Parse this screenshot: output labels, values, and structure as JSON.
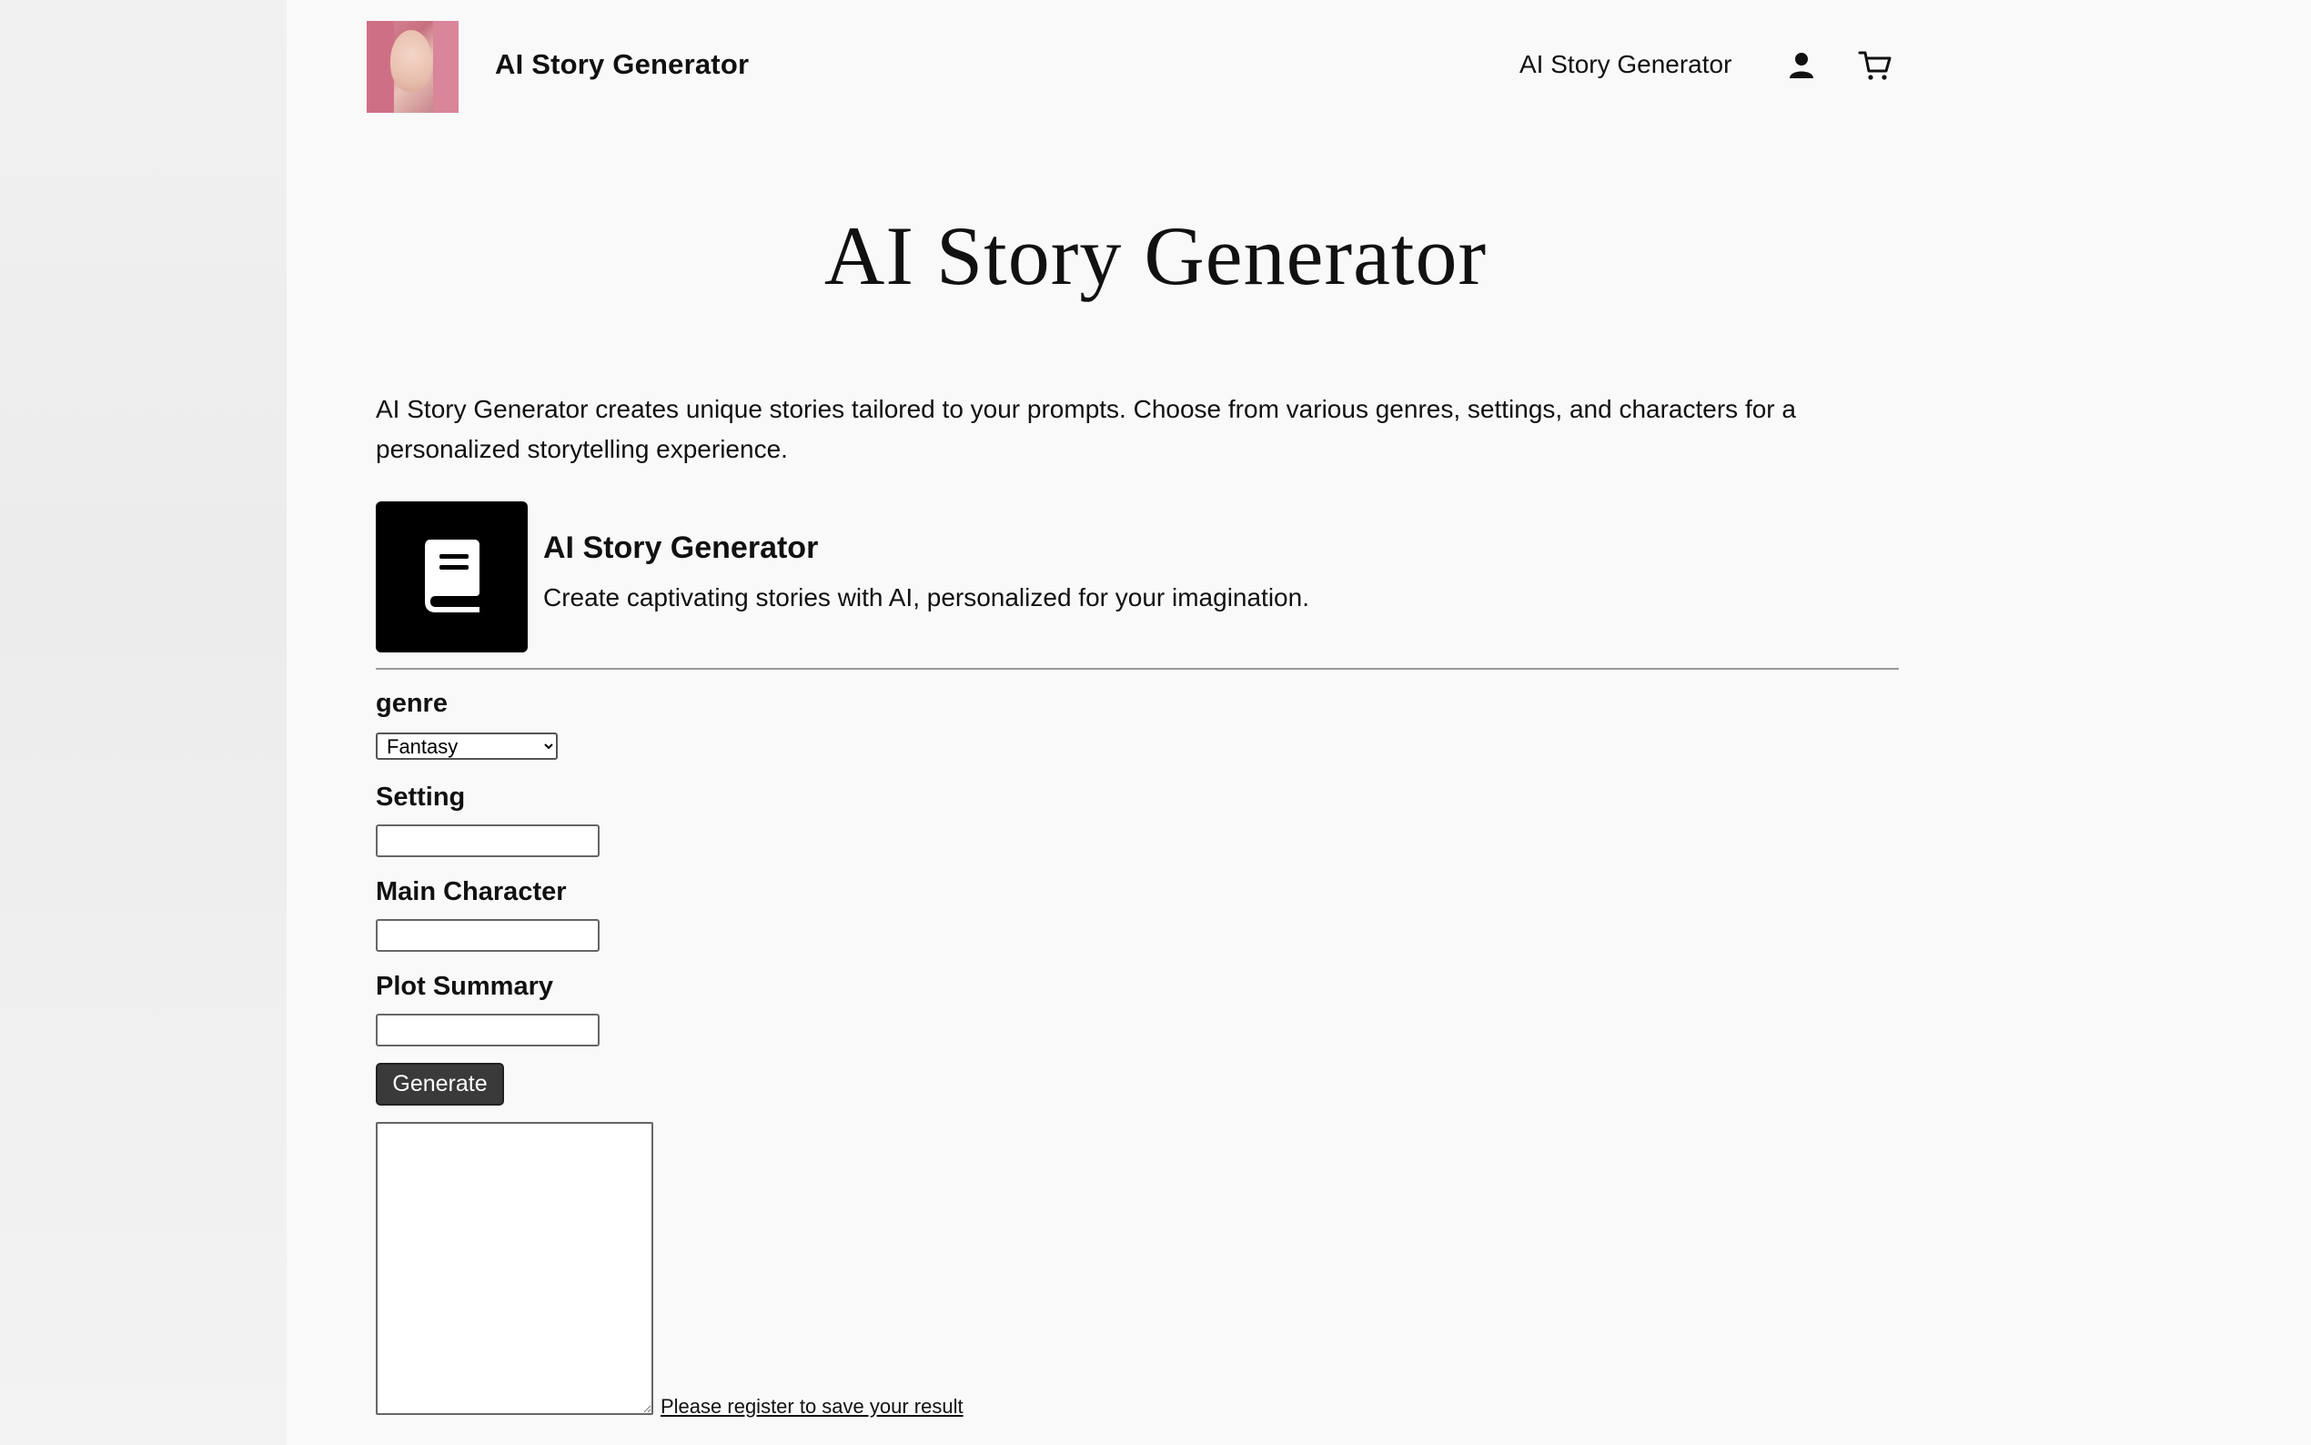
{
  "header": {
    "brand": "AI Story Generator",
    "nav_link": "AI Story Generator",
    "icons": [
      "user-icon",
      "cart-icon"
    ]
  },
  "hero": {
    "title": "AI Story Generator"
  },
  "intro": "AI Story Generator creates unique stories tailored to your prompts. Choose from various genres, settings, and characters for a personalized storytelling experience.",
  "tool": {
    "icon": "book-icon",
    "title": "AI Story Generator",
    "description": "Create captivating stories with AI, personalized for your imagination."
  },
  "form": {
    "genre_label": "genre",
    "genre_selected": "Fantasy",
    "setting_label": "Setting",
    "setting_value": "",
    "main_character_label": "Main Character",
    "main_character_value": "",
    "plot_summary_label": "Plot Summary",
    "plot_summary_value": "",
    "generate_label": "Generate",
    "result_value": "",
    "register_link": "Please register to save your result"
  }
}
